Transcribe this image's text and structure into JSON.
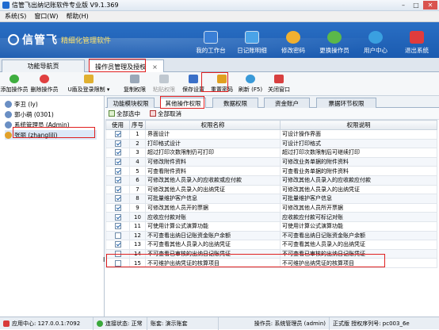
{
  "window": {
    "title": "信管飞出纳记账软件专业版 V9.1.369",
    "minimize": "–",
    "maximize": "□",
    "close": "✕"
  },
  "menu": [
    "系统(S)",
    "窗口(W)",
    "帮助(H)"
  ],
  "banner": {
    "brand": "信管飞",
    "slogan": "精细化管理软件"
  },
  "topnav": [
    {
      "label": "我的工作台",
      "icon": "desktop-icon",
      "color": "#3a7fd6"
    },
    {
      "label": "日记账明细",
      "icon": "ledger-icon",
      "color": "#4aa3e8"
    },
    {
      "label": "修改密码",
      "icon": "password-icon",
      "color": "#f0b030"
    },
    {
      "label": "更换操作员",
      "icon": "switch-user-icon",
      "color": "#5bb84a"
    },
    {
      "label": "用户中心",
      "icon": "user-center-icon",
      "color": "#3aa0e0"
    },
    {
      "label": "退出系统",
      "icon": "power-icon",
      "color": "#e03c3c"
    }
  ],
  "tabs": [
    {
      "label": "功能导航页"
    },
    {
      "label": "操作员管理及授权",
      "close": "×"
    }
  ],
  "toolbar": [
    {
      "label": "添加操作员",
      "icon": "add-user-icon",
      "color": "#3fae3f"
    },
    {
      "label": "删除操作员",
      "icon": "delete-user-icon",
      "color": "#e04040"
    },
    {
      "label": "U盾及登录限制 ▾",
      "icon": "shield-icon",
      "color": "#e0b030"
    },
    {
      "label": "复制权限",
      "icon": "copy-icon",
      "color": "#9aa8b8"
    },
    {
      "label": "粘贴权限",
      "icon": "paste-icon",
      "color": "#c0c8d0"
    },
    {
      "label": "保存设置",
      "icon": "save-icon",
      "color": "#3a70c8"
    },
    {
      "label": "重置密码",
      "icon": "reset-password-icon",
      "color": "#e0a020"
    },
    {
      "label": "刷新 (F5)",
      "icon": "refresh-icon",
      "color": "#3a9ad8"
    },
    {
      "label": "关闭窗口",
      "icon": "close-window-icon",
      "color": "#d84040"
    }
  ],
  "users": [
    {
      "label": "李丑 (ly)"
    },
    {
      "label": "郭小萌 (0301)"
    },
    {
      "label": "系统管理员 (Admin)"
    },
    {
      "label": "张丽 (zhanglili)"
    }
  ],
  "subtabs": [
    "功能模块权限",
    "其他操作权限",
    "数据权限",
    "资金账户",
    "票据环节权限"
  ],
  "select": {
    "all": "全部选中",
    "none": "全部取消"
  },
  "columns": [
    "使用",
    "序号",
    "权限名称",
    "权限说明"
  ],
  "rows": [
    {
      "use": true,
      "no": "1",
      "name": "界面设计",
      "desc": "可设计操作界面"
    },
    {
      "use": true,
      "no": "2",
      "name": "打印格式设计",
      "desc": "可设计打印格式"
    },
    {
      "use": true,
      "no": "3",
      "name": "超过打印次数限制仍可打印",
      "desc": "超过打印次数限制后可继续打印"
    },
    {
      "use": true,
      "no": "4",
      "name": "可修改附件资料",
      "desc": "可修改业务单据的附件资料"
    },
    {
      "use": true,
      "no": "5",
      "name": "可查看附件资料",
      "desc": "可查看业务单据的附件资料"
    },
    {
      "use": true,
      "no": "6",
      "name": "可修改其他人员录入的应收款或应付款",
      "desc": "可修改其他人员录入的应收款应付款"
    },
    {
      "use": true,
      "no": "7",
      "name": "可修改其他人员录入的出纳凭证",
      "desc": "可修改其他人员录入的出纳凭证"
    },
    {
      "use": true,
      "no": "8",
      "name": "可批量维护客户信息",
      "desc": "可批量维护客户信息"
    },
    {
      "use": true,
      "no": "9",
      "name": "可修改其他人员开的票据",
      "desc": "可修改其他人员所开票据"
    },
    {
      "use": true,
      "no": "10",
      "name": "应收应付款对账",
      "desc": "应收款应付款可标记对账"
    },
    {
      "use": true,
      "no": "11",
      "name": "可使用计算公式演算功能",
      "desc": "可使用计算公式演算功能"
    },
    {
      "use": false,
      "no": "12",
      "name": "不可查看出纳日记账资金账户余额",
      "desc": "不可查看出纳日记账资金账户余额"
    },
    {
      "use": true,
      "no": "13",
      "name": "不可查看其他人员录入的出纳凭证",
      "desc": "不可查看其他人员录入的出纳凭证"
    },
    {
      "use": false,
      "no": "14",
      "name": "不可查看已审核的出纳日记账凭证",
      "desc": "不可查看已审核的出纳日记账凭证"
    },
    {
      "use": false,
      "no": "15",
      "name": "不可维护出纳凭证的核算项目",
      "desc": "不可维护出纳凭证的核算项目"
    }
  ],
  "row_marker": "I",
  "status": {
    "app_center": "应用中心: 127.0.0.1:7092",
    "connection": "连接状态: 正常",
    "account": "账套: 演示账套",
    "operator": "操作员: 系统管理员 (admin)",
    "version": "正式版 授权序列号: pc003_6e"
  }
}
